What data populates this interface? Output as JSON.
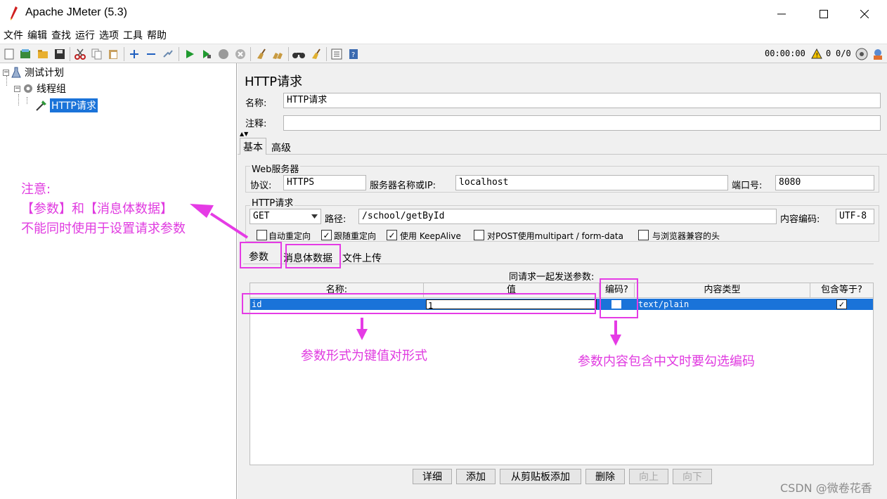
{
  "window": {
    "title": "Apache JMeter (5.3)",
    "controls": {
      "minimize": "—",
      "maximize": "☐",
      "close": "✕"
    }
  },
  "menu": [
    "文件",
    "编辑",
    "查找",
    "运行",
    "选项",
    "工具",
    "帮助"
  ],
  "toolbar": {
    "timer": "00:00:00",
    "warn_count": "0",
    "threads": "0/0"
  },
  "tree": {
    "root": "测试计划",
    "thread_group": "线程组",
    "sampler": "HTTP请求"
  },
  "panel": {
    "title": "HTTP请求",
    "name_label": "名称:",
    "name_value": "HTTP请求",
    "comment_label": "注释:",
    "comment_value": "",
    "tabs": [
      "基本",
      "高级"
    ],
    "web_server": {
      "group_label": "Web服务器",
      "protocol_label": "协议:",
      "protocol_value": "HTTPS",
      "server_label": "服务器名称或IP:",
      "server_value": "localhost",
      "port_label": "端口号:",
      "port_value": "8080"
    },
    "http_request": {
      "group_label": "HTTP请求",
      "method": "GET",
      "path_label": "路径:",
      "path_value": "/school/getById",
      "encoding_label": "内容编码:",
      "encoding_value": "UTF-8"
    },
    "options": [
      {
        "label": "自动重定向",
        "checked": false
      },
      {
        "label": "跟随重定向",
        "checked": true
      },
      {
        "label": "使用 KeepAlive",
        "checked": true
      },
      {
        "label": "对POST使用multipart / form-data",
        "checked": false
      },
      {
        "label": "与浏览器兼容的头",
        "checked": false
      }
    ],
    "subtabs": [
      "参数",
      "消息体数据",
      "文件上传"
    ],
    "params_caption": "同请求一起发送参数:",
    "table": {
      "headers": [
        "名称:",
        "值",
        "编码?",
        "内容类型",
        "包含等于?"
      ],
      "rows": [
        {
          "name": "id",
          "value": "1",
          "encode": false,
          "content_type": "text/plain",
          "include_equals": true
        }
      ]
    },
    "buttons": {
      "detail": "详细",
      "add": "添加",
      "add_clipboard": "从剪贴板添加",
      "delete": "删除",
      "up": "向上",
      "down": "向下"
    }
  },
  "annotations": {
    "note_title": "注意:",
    "note_line1": "【参数】和【消息体数据】",
    "note_line2": "不能同时使用于设置请求参数",
    "kv_note": "参数形式为键值对形式",
    "encode_note": "参数内容包含中文时要勾选编码",
    "color": "#e03be0"
  },
  "watermark": "CSDN @微卷花香"
}
